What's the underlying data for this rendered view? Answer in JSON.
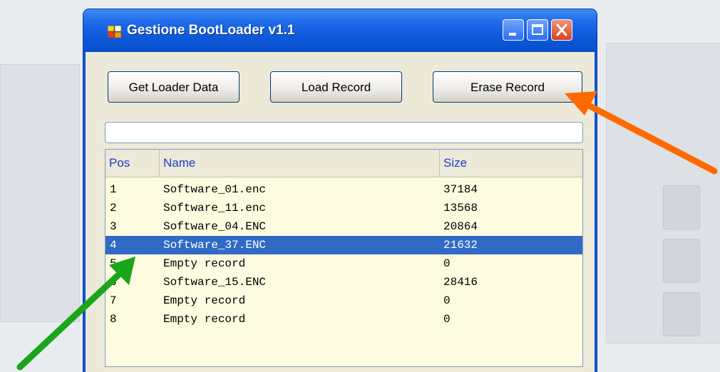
{
  "window": {
    "title": "Gestione BootLoader v1.1",
    "controls": [
      "minimize",
      "maximize",
      "close"
    ]
  },
  "toolbar": {
    "get_loader_data_label": "Get Loader Data",
    "load_record_label": "Load Record",
    "erase_record_label": "Erase Record"
  },
  "progress": {
    "value": ""
  },
  "list": {
    "columns": {
      "pos": "Pos",
      "name": "Name",
      "size": "Size"
    },
    "rows": [
      {
        "pos": "1",
        "name": "Software_01.enc",
        "size": "37184"
      },
      {
        "pos": "2",
        "name": "Software_11.enc",
        "size": "13568"
      },
      {
        "pos": "3",
        "name": "Software_04.ENC",
        "size": "20864"
      },
      {
        "pos": "4",
        "name": "Software_37.ENC",
        "size": "21632",
        "selected": true
      },
      {
        "pos": "5",
        "name": "Empty record",
        "size": "0"
      },
      {
        "pos": "6",
        "name": "Software_15.ENC",
        "size": "28416"
      },
      {
        "pos": "7",
        "name": "Empty record",
        "size": "0"
      },
      {
        "pos": "8",
        "name": "Empty record",
        "size": "0"
      }
    ]
  },
  "annotations": {
    "orange_arrow_color": "#ff6a00",
    "green_arrow_color": "#1aa51a"
  },
  "colors": {
    "titlebar": "#0a57d9",
    "selection": "#316ac5",
    "list_background": "#fefce0",
    "header_text": "#1e3cc8"
  }
}
